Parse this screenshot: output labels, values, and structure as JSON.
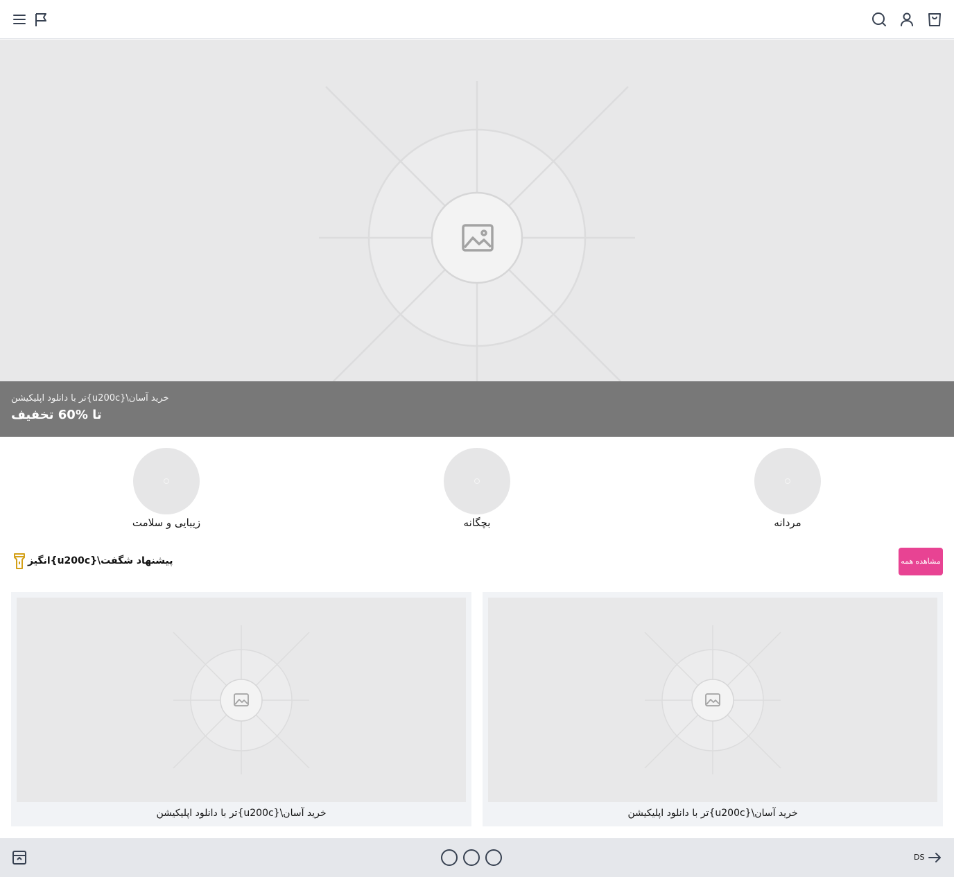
{
  "header": {
    "icons": {
      "menu": "menu-icon",
      "flag": "flag-icon",
      "search": "search-icon",
      "account": "user-icon",
      "cart": "shopping-bag-icon"
    }
  },
  "hero": {
    "image": "image-placeholder",
    "promo_subtitle": "تر با دانلود اپلیکیشن{u200c}\\خرید آسان",
    "promo_title": "تا %60 تخفیف"
  },
  "categories": [
    {
      "label": "زیبایی و سلامت"
    },
    {
      "label": "بچگانه"
    },
    {
      "label": "مردانه"
    }
  ],
  "flash_section": {
    "title": "انگیز{u200c}\\پیشنهاد شگفت",
    "icon": "flashlight-icon",
    "view_all_label": "مشاهده همه",
    "accent": "#e84393"
  },
  "products": [
    {
      "caption": "تر با دانلود اپلیکیشن{u200c}\\خرید آسان"
    },
    {
      "caption": "تر با دانلود اپلیکیشن{u200c}\\خرید آسان"
    }
  ],
  "footer": {
    "left_icon": "archive-icon",
    "pager_dots": 3,
    "next_label": "DS",
    "next_icon": "arrow-right-icon"
  },
  "colors": {
    "promo_bg": "#787878",
    "placeholder_bg": "#e8e8e9",
    "bottombar_bg": "#e5e7eb"
  }
}
